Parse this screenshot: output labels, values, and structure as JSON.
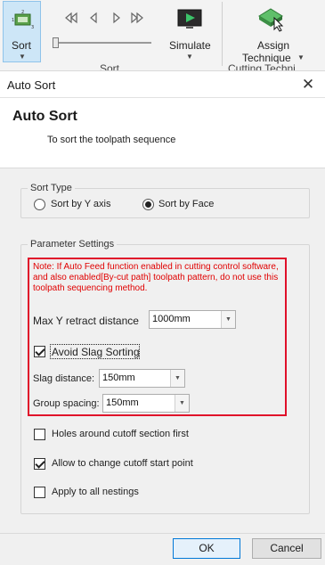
{
  "ribbon": {
    "sort_label": "Sort",
    "simulate_label": "Simulate",
    "assign_label_line1": "Assign",
    "assign_label_line2": "Technique",
    "group_label_left": "Sort",
    "group_label_right": "Cutting Techni"
  },
  "dialog": {
    "window_title": "Auto Sort",
    "heading": "Auto Sort",
    "subtitle": "To sort the toolpath sequence",
    "sort_type": {
      "legend": "Sort Type",
      "option_y": "Sort by Y axis",
      "option_face": "Sort by Face",
      "selected": "Sort by Face"
    },
    "params": {
      "legend": "Parameter Settings",
      "note": "Note: If Auto Feed function enabled in cutting control software, and also enabled[By-cut path] toolpath pattern, do not use this toolpath sequencing method.",
      "max_y_label": "Max Y retract distance",
      "max_y_value": "1000mm",
      "avoid_slag_label": "Avoid Slag Sorting",
      "avoid_slag_checked": true,
      "slag_distance_label": "Slag distance:",
      "slag_distance_value": "150mm",
      "group_spacing_label": "Group spacing:",
      "group_spacing_value": "150mm",
      "holes_label": "Holes around cutoff section first",
      "holes_checked": false,
      "allow_change_label": "Allow to change cutoff start point",
      "allow_change_checked": true,
      "apply_all_label": "Apply to all nestings",
      "apply_all_checked": false
    },
    "ok_label": "OK",
    "cancel_label": "Cancel"
  },
  "colors": {
    "note_red": "#e00000",
    "highlight_border": "#e0102a",
    "ok_border": "#0078d7"
  }
}
